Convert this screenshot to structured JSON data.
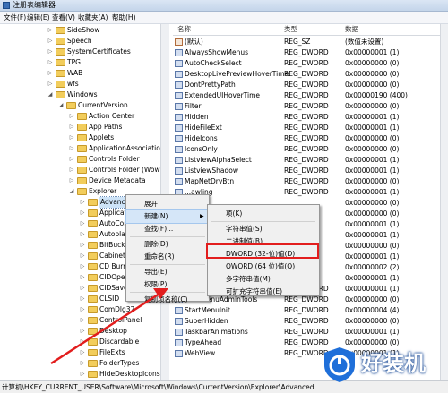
{
  "window": {
    "title": "注册表编辑器"
  },
  "menu": [
    "文件(F)",
    "编辑(E)",
    "查看(V)",
    "收藏夹(A)",
    "帮助(H)"
  ],
  "tree": [
    {
      "label": "SideShow",
      "expander": "▷"
    },
    {
      "label": "Speech",
      "expander": "▷"
    },
    {
      "label": "SystemCertificates",
      "expander": "▷"
    },
    {
      "label": "TPG",
      "expander": "▷"
    },
    {
      "label": "WAB",
      "expander": "▷"
    },
    {
      "label": "wfs",
      "expander": "▷"
    },
    {
      "label": "Windows",
      "expander": "◢"
    },
    {
      "label": "CurrentVersion",
      "expander": "◢"
    },
    {
      "label": "Action Center",
      "expander": "▷"
    },
    {
      "label": "App Paths",
      "expander": "▷"
    },
    {
      "label": "Applets",
      "expander": "▷"
    },
    {
      "label": "ApplicationAssociationTo",
      "expander": "▷"
    },
    {
      "label": "Controls Folder",
      "expander": "▷"
    },
    {
      "label": "Controls Folder (Wow64)",
      "expander": "▷"
    },
    {
      "label": "Device Metadata",
      "expander": "▷"
    },
    {
      "label": "Explorer",
      "expander": "◢"
    },
    {
      "label": "Advanced",
      "expander": "▷",
      "selected": true
    },
    {
      "label": "Applicatio",
      "expander": "▷"
    },
    {
      "label": "AutoComp",
      "expander": "▷"
    },
    {
      "label": "Autoplayh",
      "expander": "▷"
    },
    {
      "label": "BitBucket",
      "expander": "▷"
    },
    {
      "label": "CabinetSt",
      "expander": "▷"
    },
    {
      "label": "CD Burnin",
      "expander": "▷"
    },
    {
      "label": "CIDOpen",
      "expander": "▷"
    },
    {
      "label": "CIDSave",
      "expander": "▷"
    },
    {
      "label": "CLSID",
      "expander": "▷"
    },
    {
      "label": "ComDlg32",
      "expander": "▷"
    },
    {
      "label": "ControlPanel",
      "expander": "▷"
    },
    {
      "label": "Desktop",
      "expander": "▷"
    },
    {
      "label": "Discardable",
      "expander": "▷"
    },
    {
      "label": "FileExts",
      "expander": "▷"
    },
    {
      "label": "FolderTypes",
      "expander": "▷"
    },
    {
      "label": "HideDesktopIcons",
      "expander": "▷"
    }
  ],
  "list": {
    "headers": {
      "name": "名称",
      "type": "类型",
      "data": "数据"
    },
    "rows": [
      {
        "name": "(默认)",
        "type": "REG_SZ",
        "data": "(数值未设置)",
        "kind": "str"
      },
      {
        "name": "AlwaysShowMenus",
        "type": "REG_DWORD",
        "data": "0x00000001 (1)",
        "kind": "bin"
      },
      {
        "name": "AutoCheckSelect",
        "type": "REG_DWORD",
        "data": "0x00000000 (0)",
        "kind": "bin"
      },
      {
        "name": "DesktopLivePreviewHoverTime",
        "type": "REG_DWORD",
        "data": "0x00000000 (0)",
        "kind": "bin"
      },
      {
        "name": "DontPrettyPath",
        "type": "REG_DWORD",
        "data": "0x00000000 (0)",
        "kind": "bin"
      },
      {
        "name": "ExtendedUIHoverTime",
        "type": "REG_DWORD",
        "data": "0x00000190 (400)",
        "kind": "bin"
      },
      {
        "name": "Filter",
        "type": "REG_DWORD",
        "data": "0x00000000 (0)",
        "kind": "bin"
      },
      {
        "name": "Hidden",
        "type": "REG_DWORD",
        "data": "0x00000001 (1)",
        "kind": "bin"
      },
      {
        "name": "HideFileExt",
        "type": "REG_DWORD",
        "data": "0x00000001 (1)",
        "kind": "bin"
      },
      {
        "name": "HideIcons",
        "type": "REG_DWORD",
        "data": "0x00000000 (0)",
        "kind": "bin"
      },
      {
        "name": "IconsOnly",
        "type": "REG_DWORD",
        "data": "0x00000000 (0)",
        "kind": "bin"
      },
      {
        "name": "ListviewAlphaSelect",
        "type": "REG_DWORD",
        "data": "0x00000001 (1)",
        "kind": "bin"
      },
      {
        "name": "ListviewShadow",
        "type": "REG_DWORD",
        "data": "0x00000001 (1)",
        "kind": "bin"
      },
      {
        "name": "MapNetDrvBtn",
        "type": "REG_DWORD",
        "data": "0x00000000 (0)",
        "kind": "bin"
      },
      {
        "name": "...awling",
        "type": "REG_DWORD",
        "data": "0x00000001 (1)",
        "kind": "bin"
      },
      {
        "name": "",
        "type": "",
        "data": "0x00000000 (0)",
        "kind": "bin"
      },
      {
        "name": "",
        "type": "",
        "data": "0x00000000 (0)",
        "kind": "bin"
      },
      {
        "name": "",
        "type": "",
        "data": "0x00000001 (1)",
        "kind": "bin"
      },
      {
        "name": "",
        "type": "",
        "data": "0x00000001 (1)",
        "kind": "bin"
      },
      {
        "name": "",
        "type": "",
        "data": "0x00000000 (0)",
        "kind": "bin"
      },
      {
        "name": "",
        "type": "",
        "data": "0x00000001 (1)",
        "kind": "bin"
      },
      {
        "name": "",
        "type": "",
        "data": "0x00000002 (2)",
        "kind": "bin"
      },
      {
        "name": "",
        "type": "",
        "data": "0x00000001 (1)",
        "kind": "bin"
      },
      {
        "name": "...owRun",
        "type": "REG_DWORD",
        "data": "0x00000001 (1)",
        "kind": "bin"
      },
      {
        "name": "StartMenuAdminTools",
        "type": "REG_DWORD",
        "data": "0x00000000 (0)",
        "kind": "bin"
      },
      {
        "name": "StartMenuInit",
        "type": "REG_DWORD",
        "data": "0x00000004 (4)",
        "kind": "bin"
      },
      {
        "name": "SuperHidden",
        "type": "REG_DWORD",
        "data": "0x00000000 (0)",
        "kind": "bin"
      },
      {
        "name": "TaskbarAnimations",
        "type": "REG_DWORD",
        "data": "0x00000001 (1)",
        "kind": "bin"
      },
      {
        "name": "TypeAhead",
        "type": "REG_DWORD",
        "data": "0x00000000 (0)",
        "kind": "bin"
      },
      {
        "name": "WebView",
        "type": "REG_DWORD",
        "data": "0x00000001 (1)",
        "kind": "bin"
      }
    ]
  },
  "context_menu": {
    "items": [
      {
        "label": "展开",
        "type": "item"
      },
      {
        "label": "新建(N)",
        "type": "submenu",
        "arrow": "▶",
        "highlighted": true
      },
      {
        "label": "查找(F)...",
        "type": "item"
      },
      {
        "type": "sep"
      },
      {
        "label": "删除(D)",
        "type": "item"
      },
      {
        "label": "重命名(R)",
        "type": "item"
      },
      {
        "type": "sep"
      },
      {
        "label": "导出(E)",
        "type": "item"
      },
      {
        "label": "权限(P)...",
        "type": "item"
      },
      {
        "type": "sep"
      },
      {
        "label": "复制项名称(C)",
        "type": "item"
      }
    ]
  },
  "submenu": {
    "items": [
      {
        "label": "项(K)",
        "type": "item"
      },
      {
        "type": "sep"
      },
      {
        "label": "字符串值(S)",
        "type": "item"
      },
      {
        "label": "二进制值(B)",
        "type": "item"
      },
      {
        "label": "DWORD (32-位)值(D)",
        "type": "item",
        "outlined": true
      },
      {
        "label": "QWORD (64 位)值(Q)",
        "type": "item"
      },
      {
        "label": "多字符串值(M)",
        "type": "item"
      },
      {
        "label": "可扩充字符串值(E)",
        "type": "item"
      }
    ]
  },
  "status": {
    "path": "计算机\\HKEY_CURRENT_USER\\Software\\Microsoft\\Windows\\CurrentVersion\\Explorer\\Advanced"
  },
  "watermark": {
    "text": "好装机"
  },
  "colors": {
    "annotation_red": "#e21d1d",
    "logo_blue": "#1f6fd9"
  }
}
